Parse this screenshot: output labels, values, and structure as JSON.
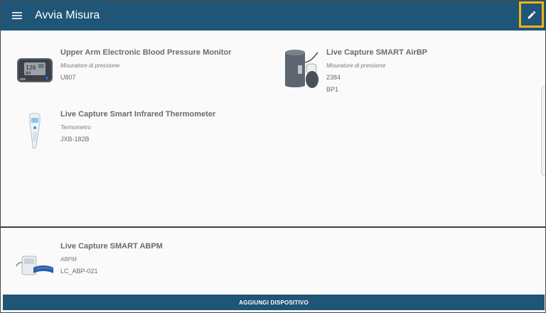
{
  "appbar": {
    "title": "Avvia Misura",
    "menu_icon": "menu-icon",
    "edit_icon": "pencil-icon",
    "accent": "#1f5577",
    "highlight": "#f3b21b"
  },
  "devices": [
    {
      "name": "Upper Arm Electronic Blood Pressure Monitor",
      "category": "Misuratore di pressione",
      "lines": [
        "U807"
      ],
      "image": "blood-pressure-monitor-image"
    },
    {
      "name": "Live Capture SMART AirBP",
      "category": "Misuratore di pressione",
      "lines": [
        "2384",
        "BP1"
      ],
      "image": "airbp-cuff-image"
    },
    {
      "name": "Live Capture Smart Infrared Thermometer",
      "category": "Termometro",
      "lines": [
        "JXB-182B"
      ],
      "image": "thermometer-image"
    },
    {
      "name": "Live Capture SMART ABPM",
      "category": "ABPM",
      "lines": [
        "LC_ABP-021"
      ],
      "image": "abpm-device-image"
    }
  ],
  "footer": {
    "add_label": "AGGIUNGI DISPOSITIVO"
  }
}
